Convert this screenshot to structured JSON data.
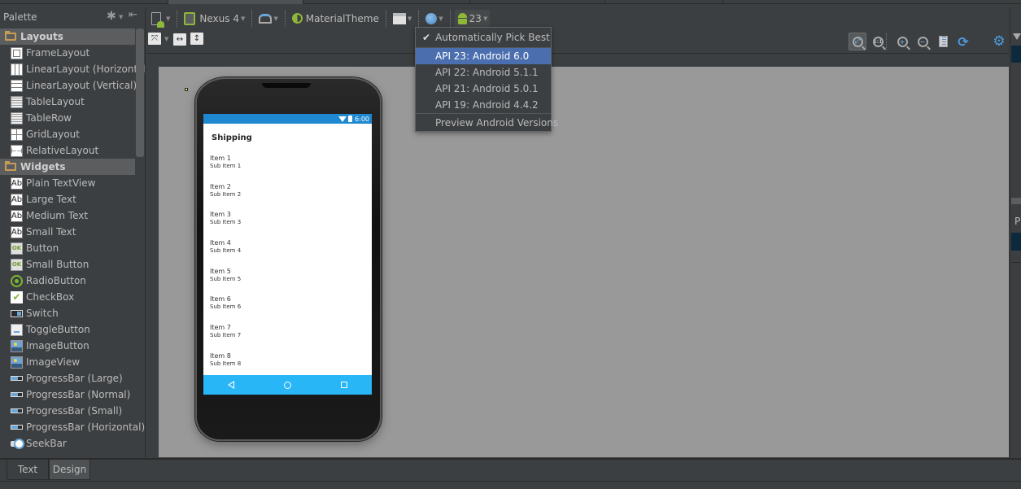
{
  "palette": {
    "title": "Palette",
    "groups": [
      {
        "label": "Layouts",
        "items": [
          {
            "label": "FrameLayout",
            "icon": "frame-layout-icon"
          },
          {
            "label": "LinearLayout (Horizontal)",
            "icon": "linear-layout-horizontal-icon"
          },
          {
            "label": "LinearLayout (Vertical)",
            "icon": "linear-layout-vertical-icon"
          },
          {
            "label": "TableLayout",
            "icon": "table-layout-icon"
          },
          {
            "label": "TableRow",
            "icon": "table-row-icon"
          },
          {
            "label": "GridLayout",
            "icon": "grid-layout-icon"
          },
          {
            "label": "RelativeLayout",
            "icon": "relative-layout-icon"
          }
        ]
      },
      {
        "label": "Widgets",
        "items": [
          {
            "label": "Plain TextView",
            "icon": "textview-icon",
            "glyph": "Ab"
          },
          {
            "label": "Large Text",
            "icon": "textview-icon",
            "glyph": "Ab"
          },
          {
            "label": "Medium Text",
            "icon": "textview-icon",
            "glyph": "Ab"
          },
          {
            "label": "Small Text",
            "icon": "textview-icon",
            "glyph": "Ab"
          },
          {
            "label": "Button",
            "icon": "button-icon",
            "glyph": "OK"
          },
          {
            "label": "Small Button",
            "icon": "button-icon",
            "glyph": "OK"
          },
          {
            "label": "RadioButton",
            "icon": "radio-button-icon"
          },
          {
            "label": "CheckBox",
            "icon": "checkbox-icon",
            "glyph": "✔"
          },
          {
            "label": "Switch",
            "icon": "switch-icon"
          },
          {
            "label": "ToggleButton",
            "icon": "toggle-button-icon"
          },
          {
            "label": "ImageButton",
            "icon": "image-button-icon"
          },
          {
            "label": "ImageView",
            "icon": "image-view-icon"
          },
          {
            "label": "ProgressBar (Large)",
            "icon": "progress-bar-icon"
          },
          {
            "label": "ProgressBar (Normal)",
            "icon": "progress-bar-icon"
          },
          {
            "label": "ProgressBar (Small)",
            "icon": "progress-bar-icon"
          },
          {
            "label": "ProgressBar (Horizontal)",
            "icon": "progress-bar-icon"
          },
          {
            "label": "SeekBar",
            "icon": "seek-bar-icon"
          }
        ]
      }
    ]
  },
  "toolbar": {
    "device": "Nexus 4",
    "theme": "MaterialTheme",
    "api_level": "23"
  },
  "api_dropdown": {
    "auto": "Automatically Pick Best",
    "auto_checked": true,
    "options": [
      {
        "label": "API 23: Android 6.0",
        "selected": true
      },
      {
        "label": "API 22: Android 5.1.1",
        "selected": false
      },
      {
        "label": "API 21: Android 5.0.1",
        "selected": false
      },
      {
        "label": "API 19: Android 4.4.2",
        "selected": false
      }
    ],
    "preview": "Preview Android Versions"
  },
  "preview": {
    "status_time": "6:00",
    "app_title": "Shipping",
    "items": [
      {
        "title": "Item 1",
        "sub": "Sub Item 1"
      },
      {
        "title": "Item 2",
        "sub": "Sub Item 2"
      },
      {
        "title": "Item 3",
        "sub": "Sub Item 3"
      },
      {
        "title": "Item 4",
        "sub": "Sub Item 4"
      },
      {
        "title": "Item 5",
        "sub": "Sub Item 5"
      },
      {
        "title": "Item 6",
        "sub": "Sub Item 6"
      },
      {
        "title": "Item 7",
        "sub": "Sub Item 7"
      },
      {
        "title": "Item 8",
        "sub": "Sub Item 8"
      }
    ],
    "colors": {
      "status_bar": "#1e88d0",
      "nav_bar": "#29b6f6"
    }
  },
  "right_panel": {
    "label_fragment": "P"
  },
  "bottom_tabs": [
    {
      "label": "Text",
      "active": false
    },
    {
      "label": "Design",
      "active": true
    }
  ],
  "colors": {
    "ide_background": "#3c3f41",
    "selection": "#4b6eaf",
    "canvas": "#999999",
    "android_green": "#8fb839"
  }
}
